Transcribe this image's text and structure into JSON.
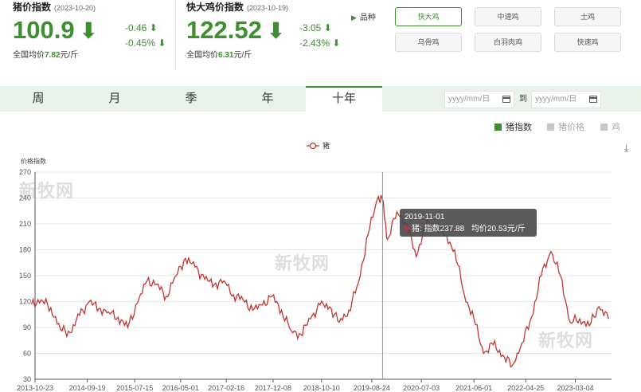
{
  "pig_index": {
    "title": "猪价指数",
    "date": "(2023-10-20)",
    "value": "100.9",
    "arrow": "⬇",
    "change_abs": "-0.46 ⬇",
    "change_pct": "-0.45% ⬇",
    "avg_label": "全国均价",
    "avg_value": "7.82",
    "avg_unit": "元/斤"
  },
  "chicken_index": {
    "title": "快大鸡价指数",
    "date": "(2023-10-19)",
    "value": "122.52",
    "arrow": "⬇",
    "change_abs": "-3.05 ⬇",
    "change_pct": "-2.43% ⬇",
    "avg_label": "全国均价",
    "avg_value": "6.31",
    "avg_unit": "元/斤"
  },
  "breeds": {
    "label": "品种",
    "items": [
      "快大鸡",
      "中速鸡",
      "土鸡",
      "乌骨鸡",
      "白羽肉鸡",
      "快速鸡"
    ],
    "active": "快大鸡"
  },
  "tabs": [
    "周",
    "月",
    "季",
    "年",
    "十年"
  ],
  "active_tab": "十年",
  "date_range": {
    "start_placeholder": "yyyy/mm/日",
    "end_placeholder": "yyyy/mm/日",
    "to_label": "到"
  },
  "toggles": [
    {
      "label": "猪指数",
      "active": true
    },
    {
      "label": "猪价格",
      "active": false
    },
    {
      "label": "鸡",
      "active": false
    }
  ],
  "colors": {
    "accent": "#3d8f2f",
    "series": "#c23531",
    "tab_bg": "#eaf3ea"
  },
  "watermark": "新牧网",
  "tooltip": {
    "date": "2019-11-01",
    "series": "猪:",
    "index_label": "指数237.88",
    "price_label": "均价20.53元/斤"
  },
  "chart_data": {
    "type": "line",
    "ylabel": "价格指数",
    "legend": [
      "猪"
    ],
    "legend_position": "top-center",
    "ylim": [
      30,
      270
    ],
    "yticks": [
      30,
      60,
      90,
      120,
      150,
      180,
      210,
      240,
      270
    ],
    "xticks": [
      "2013-10-23",
      "2014-09-19",
      "2015-07-15",
      "2016-05-01",
      "2017-02-16",
      "2017-12-08",
      "2018-10-10",
      "2019-08-24",
      "2020-07-03",
      "2021-06-01",
      "2022-04-25",
      "2023-03-04"
    ],
    "grid": true,
    "series": [
      {
        "name": "猪",
        "x": [
          "2013-10",
          "2013-12",
          "2014-02",
          "2014-04",
          "2014-06",
          "2014-08",
          "2014-10",
          "2014-12",
          "2015-02",
          "2015-04",
          "2015-06",
          "2015-08",
          "2015-10",
          "2015-12",
          "2016-02",
          "2016-04",
          "2016-06",
          "2016-08",
          "2016-10",
          "2016-12",
          "2017-02",
          "2017-04",
          "2017-06",
          "2017-08",
          "2017-10",
          "2017-12",
          "2018-02",
          "2018-04",
          "2018-06",
          "2018-08",
          "2018-10",
          "2018-12",
          "2019-02",
          "2019-04",
          "2019-06",
          "2019-08",
          "2019-10",
          "2019-11",
          "2019-12",
          "2020-02",
          "2020-04",
          "2020-06",
          "2020-08",
          "2020-10",
          "2020-12",
          "2021-02",
          "2021-04",
          "2021-06",
          "2021-08",
          "2021-10",
          "2021-12",
          "2022-02",
          "2022-04",
          "2022-06",
          "2022-08",
          "2022-10",
          "2022-12",
          "2023-02",
          "2023-04",
          "2023-06",
          "2023-08",
          "2023-10"
        ],
        "values": [
          117,
          122,
          113,
          88,
          84,
          104,
          120,
          112,
          108,
          102,
          90,
          118,
          144,
          140,
          126,
          150,
          170,
          160,
          146,
          140,
          144,
          128,
          122,
          110,
          116,
          126,
          110,
          86,
          82,
          100,
          116,
          114,
          96,
          110,
          142,
          198,
          240,
          238,
          192,
          224,
          210,
          172,
          210,
          208,
          196,
          180,
          128,
          100,
          60,
          70,
          58,
          46,
          72,
          102,
          150,
          178,
          150,
          96,
          100,
          92,
          114,
          100
        ]
      }
    ]
  }
}
